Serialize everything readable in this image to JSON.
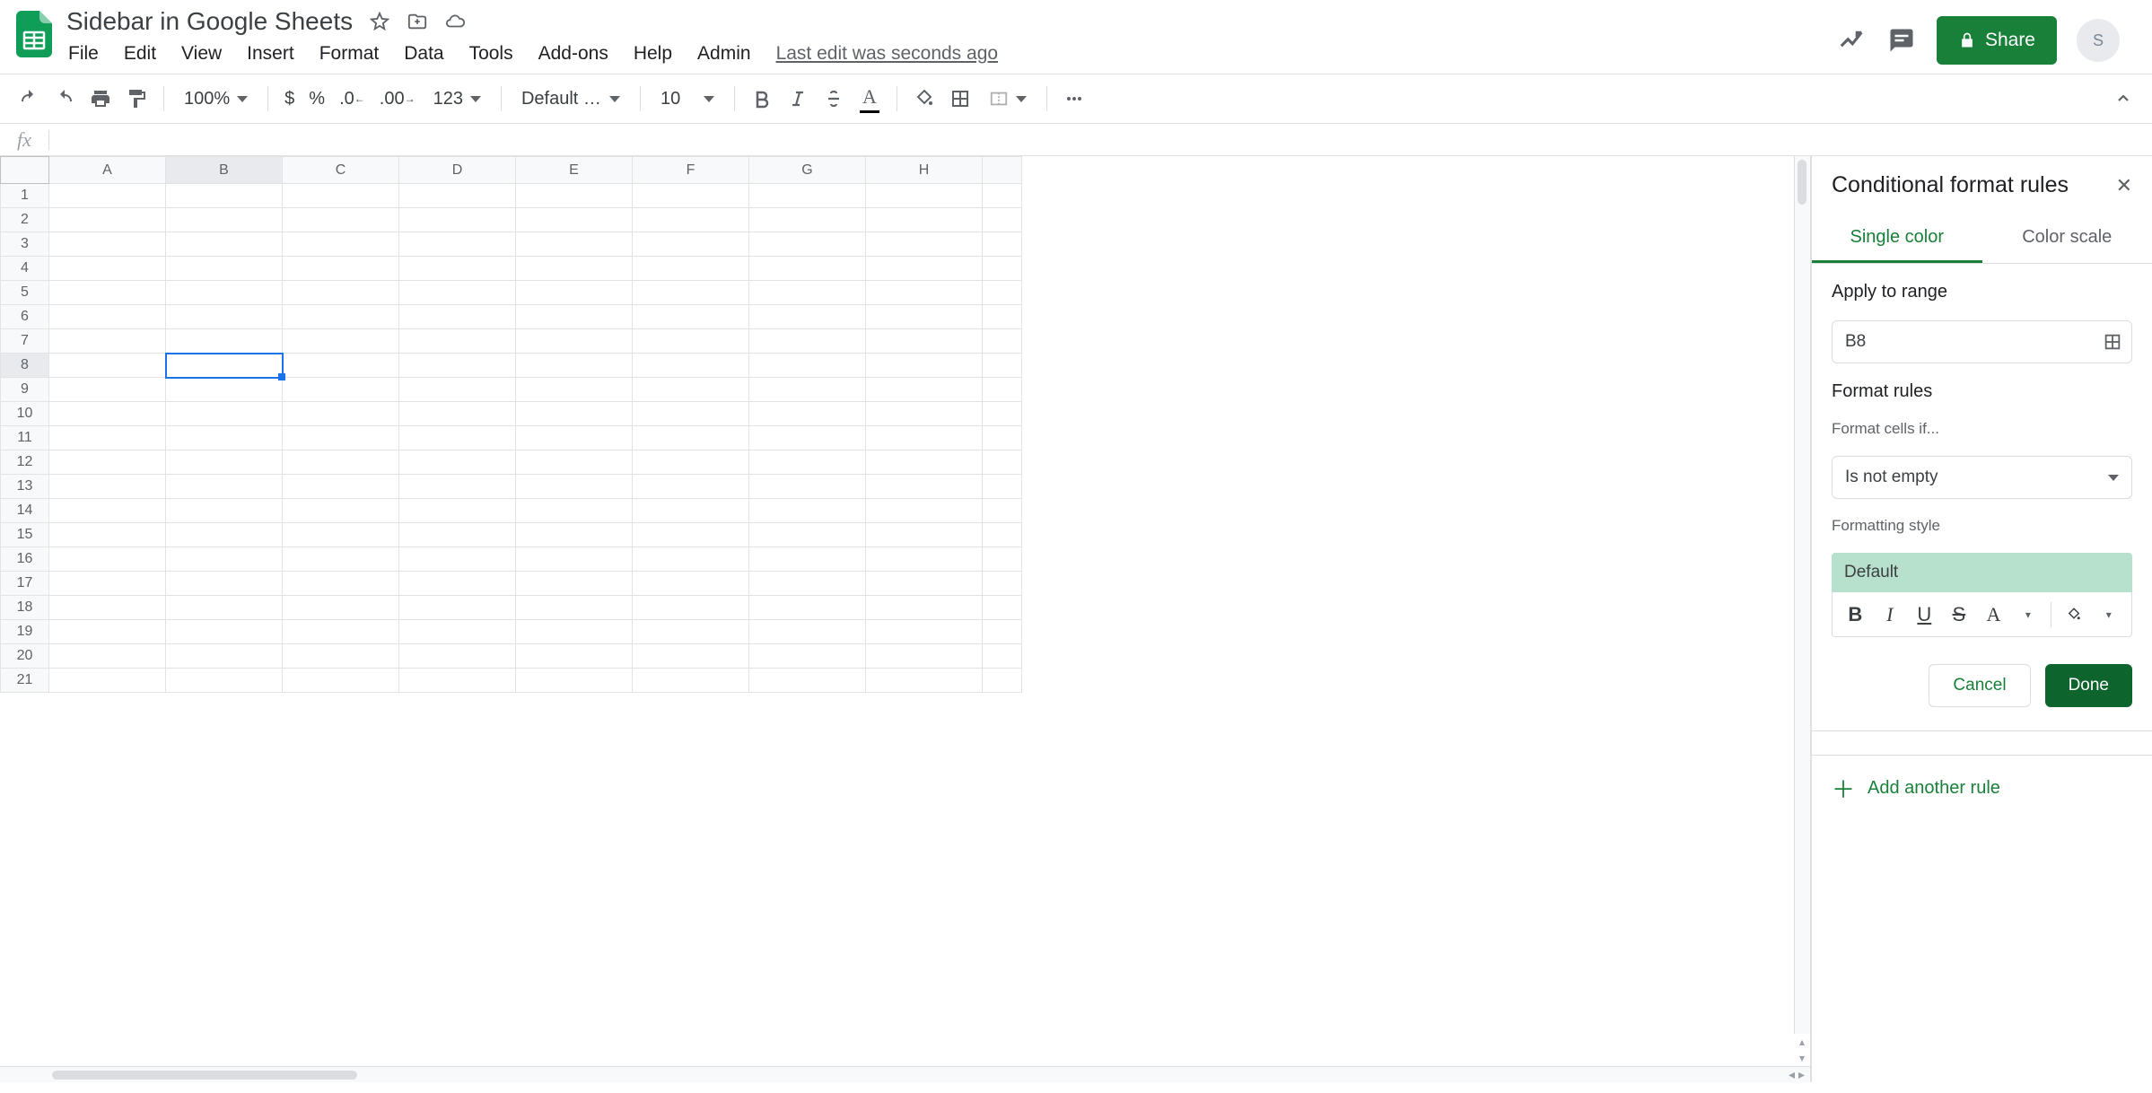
{
  "doc": {
    "title": "Sidebar in Google Sheets",
    "avatar_initial": "S"
  },
  "menus": [
    "File",
    "Edit",
    "View",
    "Insert",
    "Format",
    "Data",
    "Tools",
    "Add-ons",
    "Help",
    "Admin"
  ],
  "last_edit": "Last edit was seconds ago",
  "share_label": "Share",
  "toolbar": {
    "zoom": "100%",
    "currency": "$",
    "percent": "%",
    "dec_dec": ".0",
    "inc_dec": ".00",
    "more_formats": "123",
    "font": "Default (Ari...",
    "font_size": "10"
  },
  "grid": {
    "columns": [
      "A",
      "B",
      "C",
      "D",
      "E",
      "F",
      "G",
      "H"
    ],
    "row_count": 21,
    "selected_cell": {
      "col": "B",
      "row": 8
    }
  },
  "sidebar": {
    "title": "Conditional format rules",
    "tabs": {
      "single": "Single color",
      "scale": "Color scale"
    },
    "apply_label": "Apply to range",
    "range_value": "B8",
    "rules_label": "Format rules",
    "cells_if_label": "Format cells if...",
    "condition": "Is not empty",
    "style_label": "Formatting style",
    "style_preview": "Default",
    "cancel": "Cancel",
    "done": "Done",
    "add_rule": "Add another rule"
  }
}
